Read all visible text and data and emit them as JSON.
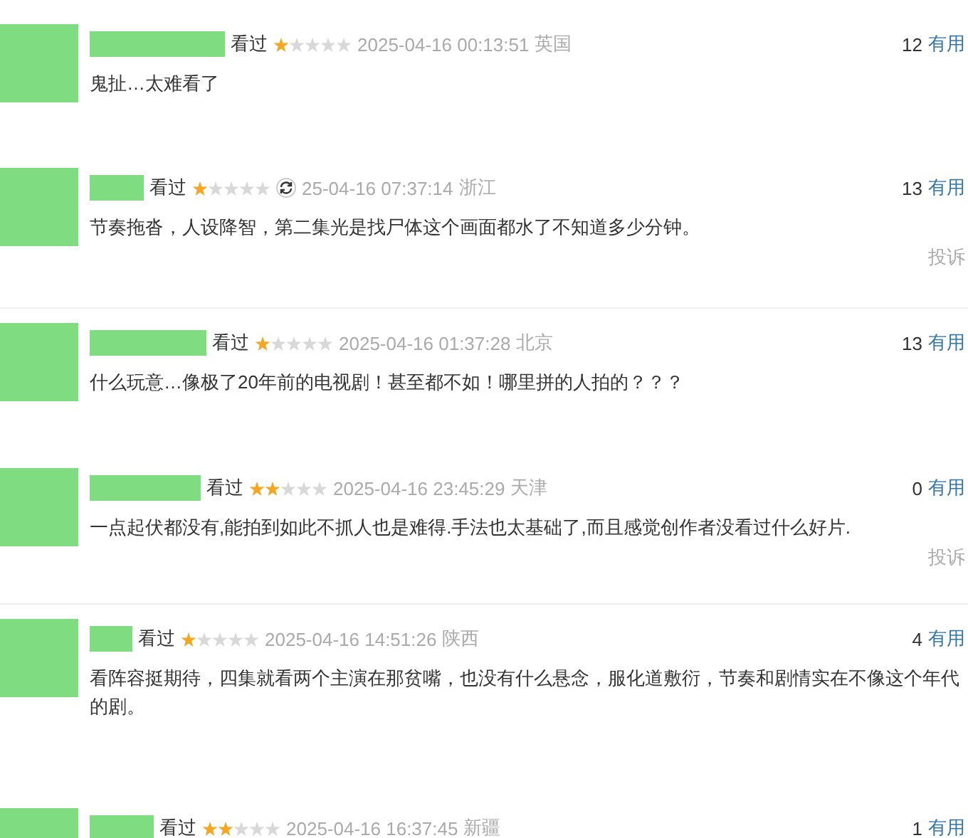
{
  "comments": [
    {
      "status": "看过",
      "stars": 1,
      "time": "2025-04-16 00:13:51",
      "location": "英国",
      "votes": "12",
      "useful": "有用",
      "text": "鬼扯…太难看了"
    },
    {
      "status": "看过",
      "stars": 1,
      "overlay_icon": true,
      "time": "25-04-16 07:37:14",
      "location": "浙江",
      "votes": "13",
      "useful": "有用",
      "text": "节奏拖沓，人设降智，第二集光是找尸体这个画面都水了不知道多少分钟。",
      "report": "投诉"
    },
    {
      "status": "看过",
      "stars": 1,
      "time": "2025-04-16 01:37:28",
      "location": "北京",
      "votes": "13",
      "useful": "有用",
      "text": "什么玩意…像极了20年前的电视剧！甚至都不如！哪里拼的人拍的？？？"
    },
    {
      "status": "看过",
      "stars": 2,
      "time": "2025-04-16 23:45:29",
      "location": "天津",
      "votes": "0",
      "useful": "有用",
      "text": "一点起伏都没有,能拍到如此不抓人也是难得.手法也太基础了,而且感觉创作者没看过什么好片.",
      "report": "投诉"
    },
    {
      "status": "看过",
      "stars": 1,
      "time": "2025-04-16 14:51:26",
      "location": "陕西",
      "votes": "4",
      "useful": "有用",
      "text": "看阵容挺期待，四集就看两个主演在那贫嘴，也没有什么悬念，服化道敷衍，节奏和剧情实在不像这个年代的剧。"
    },
    {
      "status": "看过",
      "stars": 2,
      "time": "2025-04-16 16:37:45",
      "location": "新疆",
      "votes": "1",
      "useful": "有用"
    }
  ]
}
